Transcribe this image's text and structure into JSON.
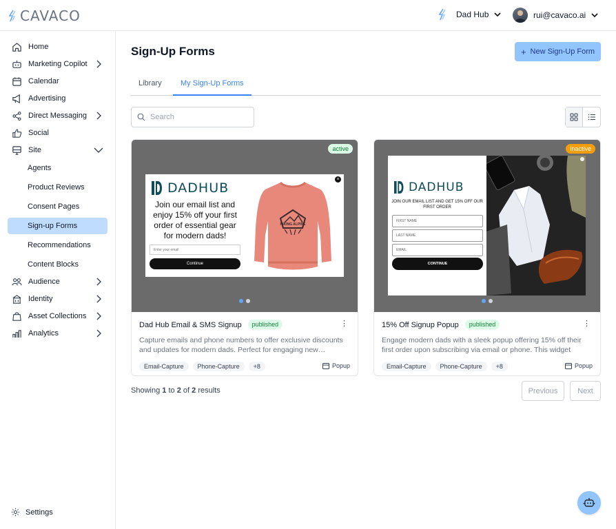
{
  "brand": {
    "name": "CAVACO"
  },
  "header": {
    "hub_name": "Dad Hub",
    "user_email": "rui@cavaco.ai"
  },
  "sidebar": {
    "items": [
      {
        "label": "Home",
        "icon": "home-icon"
      },
      {
        "label": "Marketing Copilot",
        "icon": "robot-icon"
      },
      {
        "label": "Calendar",
        "icon": "calendar-icon"
      },
      {
        "label": "Advertising",
        "icon": "megaphone-icon"
      },
      {
        "label": "Direct Messaging",
        "icon": "share-icon"
      },
      {
        "label": "Social",
        "icon": "thumbs-up-icon"
      },
      {
        "label": "Site",
        "icon": "monitor-icon"
      },
      {
        "label": "Audience",
        "icon": "users-icon"
      },
      {
        "label": "Identity",
        "icon": "building-icon"
      },
      {
        "label": "Asset Collections",
        "icon": "bag-icon"
      },
      {
        "label": "Analytics",
        "icon": "bar-chart-icon"
      }
    ],
    "site_children": [
      {
        "label": "Agents"
      },
      {
        "label": "Product Reviews"
      },
      {
        "label": "Consent Pages"
      },
      {
        "label": "Sign-up Forms"
      },
      {
        "label": "Recommendations"
      },
      {
        "label": "Content Blocks"
      }
    ],
    "settings_label": "Settings"
  },
  "main": {
    "title": "Sign-Up Forms",
    "new_button_label": "New Sign-Up Form",
    "tabs": [
      {
        "label": "Library"
      },
      {
        "label": "My Sign-Up Forms"
      }
    ],
    "search_placeholder": "Search",
    "cards": [
      {
        "status": "active",
        "title": "Dad Hub Email & SMS Signup",
        "publish_state": "published",
        "description": "Capture emails and phone numbers to offer exclusive discounts and updates for modern dads. Perfect for engaging new…",
        "tags": [
          "Email-Capture",
          "Phone-Capture",
          "+8"
        ],
        "type": "Popup",
        "preview": {
          "brand": "DADHUB",
          "headline": "Join our email list and enjoy 15% off your first order of essential gear for modern dads!",
          "email_placeholder": "Enter your email",
          "cta": "Continue",
          "shirt_print": "HIKING ALPINE"
        }
      },
      {
        "status": "inactive",
        "title": "15% Off Signup Popup",
        "publish_state": "published",
        "description": "Engage modern dads with a sleek popup offering 15% off their first order upon subscribing via email or phone. This widget captures…",
        "tags": [
          "Email-Capture",
          "Phone-Capture",
          "+8"
        ],
        "type": "Popup",
        "preview": {
          "brand": "DADHUB",
          "subtext": "JOIN OUR EMAIL LIST AND GET 15% OFF OUR FIRST ORDER",
          "fields": [
            "FIRST NAME",
            "LAST NAME",
            "EMAIL"
          ],
          "cta": "CONTINUE"
        }
      }
    ],
    "pagination": {
      "showing_prefix": "Showing",
      "from": "1",
      "to_word": "to",
      "to": "2",
      "of_word": "of",
      "total": "2",
      "suffix": "results",
      "previous_label": "Previous",
      "next_label": "Next"
    }
  },
  "colors": {
    "accent": "#3b82f6",
    "primary_button": "#93c5fd",
    "active_nav": "#bfdbfe",
    "brand_teal": "#0f4c5c",
    "inactive_badge": "#f59e0b"
  }
}
